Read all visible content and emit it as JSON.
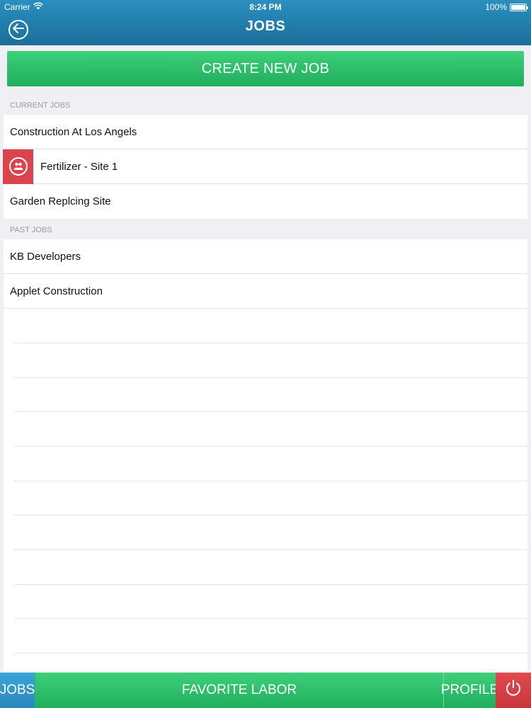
{
  "status_bar": {
    "carrier": "Carrier",
    "time": "8:24 PM",
    "battery": "100%"
  },
  "nav": {
    "title": "JOBS"
  },
  "create_button": {
    "label": "CREATE NEW JOB"
  },
  "current_jobs": {
    "header": "CURRENT JOBS",
    "items": [
      {
        "label": "Construction At Los Angels"
      },
      {
        "label": "Fertilizer - Site 1",
        "icon": "workers-icon"
      },
      {
        "label": "Garden Replcing Site"
      }
    ]
  },
  "past_jobs": {
    "header": "PAST JOBS",
    "items": [
      {
        "label": "KB Developers"
      },
      {
        "label": "Applet Construction"
      }
    ]
  },
  "tabbar": {
    "jobs": "JOBS",
    "favorite_labor": "FAVORITE LABOR",
    "profile": "PROFILE",
    "power_icon": "power-icon"
  },
  "colors": {
    "header_blue": "#1b6f9a",
    "accent_green": "#1fae5c",
    "alert_red": "#d9444d",
    "tab_blue": "#2a86bd"
  }
}
